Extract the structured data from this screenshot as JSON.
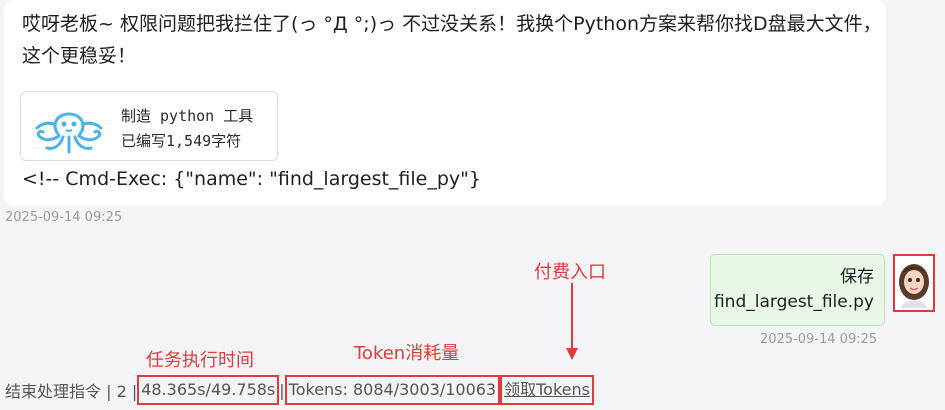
{
  "assistant_message": {
    "text": "哎呀老板~ 权限问题把我拦住了(っ °Д °;)っ 不过没关系！我换个Python方案来帮你找D盘最大文件，这个更稳妥！",
    "tool_card": {
      "title": "制造 python 工具",
      "subtitle": "已编写1,549字符",
      "icon": "octopus-icon"
    },
    "command": "<!-- Cmd-Exec: {\"name\": \"find_largest_file_py\"}",
    "timestamp": "2025-09-14 09:25"
  },
  "user_message": {
    "line1": "保存",
    "line2": "find_largest_file.py",
    "timestamp": "2025-09-14 09:25",
    "avatar": "user-avatar"
  },
  "annotations": {
    "payment": "付费入口",
    "task_time": "任务执行时间",
    "token_usage": "Token消耗量"
  },
  "status_bar": {
    "prefix": "结束处理指令 | 2 |",
    "time": "48.365s/49.758s",
    "sep1": "|",
    "tokens": "Tokens: 8084/3003/10063",
    "sep2": "|",
    "get_tokens": "领取Tokens"
  },
  "colors": {
    "annotation_red": "#e03a3a",
    "user_bubble": "#e8f7e6",
    "octopus": "#4ab3e8"
  }
}
